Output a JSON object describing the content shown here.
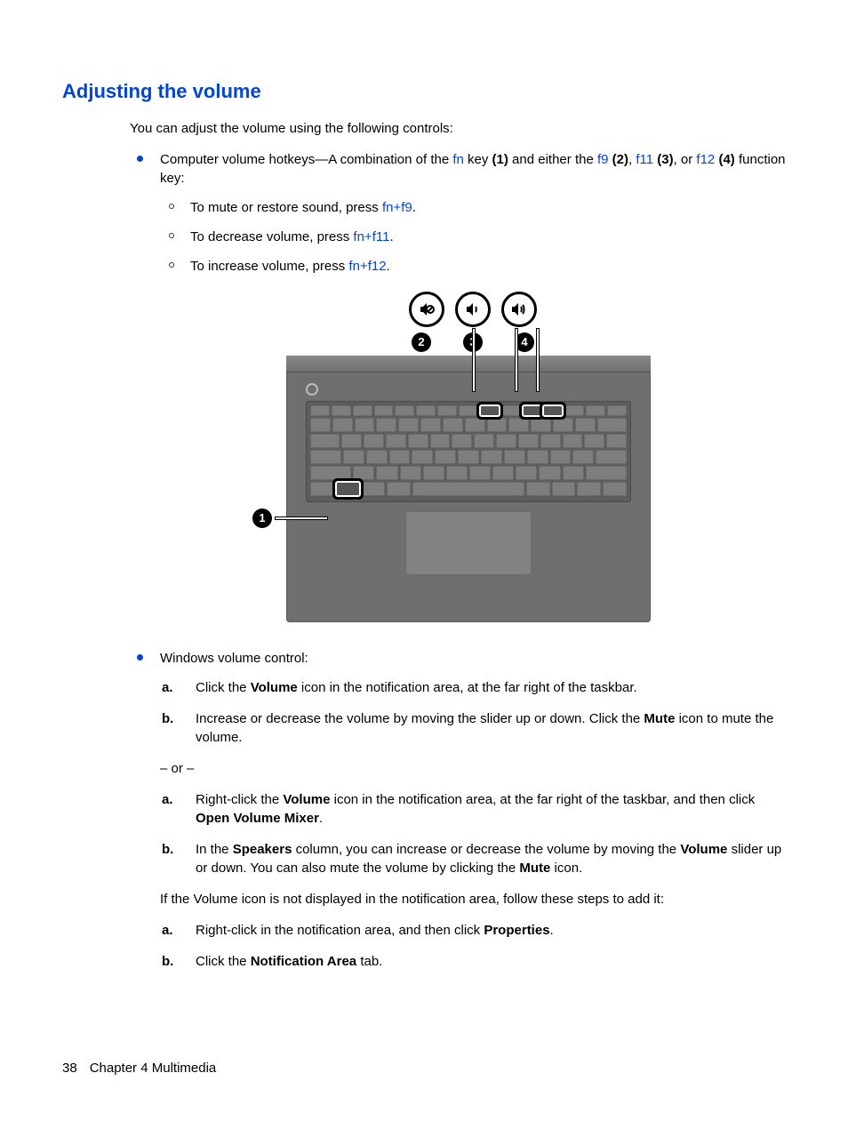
{
  "title": "Adjusting the volume",
  "intro": "You can adjust the volume using the following controls:",
  "bullet1_pre": "Computer volume hotkeys—A combination of the ",
  "fn": "fn",
  "bullet1_mid1": " key ",
  "b1_bold1": "(1)",
  "bullet1_mid2": " and either the ",
  "f9": "f9",
  "b1_bold2": " (2)",
  "comma1": ", ",
  "f11": "f11",
  "b1_bold3": " (3)",
  "comma2": ", or ",
  "f12": "f12",
  "b1_bold4": "(4)",
  "bullet1_end": " function key:",
  "sub1_pre": "To mute or restore sound, press ",
  "sub1_key": "fn+f9",
  "sub2_pre": "To decrease volume, press ",
  "sub2_key": "fn+f11",
  "sub3_pre": "To increase volume, press ",
  "sub3_key": "fn+f12",
  "period": ".",
  "bullet2": "Windows volume control:",
  "a1_pre": "Click the ",
  "a1_b": "Volume",
  "a1_post": " icon in the notification area, at the far right of the taskbar.",
  "b1_pre": "Increase or decrease the volume by moving the slider up or down. Click the ",
  "b1_b": "Mute",
  "b1_post": " icon to mute the volume.",
  "or": "– or –",
  "a2_pre": "Right-click the ",
  "a2_b1": "Volume",
  "a2_mid": " icon in the notification area, at the far right of the taskbar, and then click ",
  "a2_b2": "Open Volume Mixer",
  "b2_pre": "In the ",
  "b2_b1": "Speakers",
  "b2_mid1": " column, you can increase or decrease the volume by moving the ",
  "b2_b2": "Volume",
  "b2_mid2": " slider up or down. You can also mute the volume by clicking the ",
  "b2_b3": "Mute",
  "b2_post": " icon.",
  "if_not": "If the Volume icon is not displayed in the notification area, follow these steps to add it:",
  "a3_pre": "Right-click in the notification area, and then click ",
  "a3_b": "Properties",
  "b3_pre": "Click the ",
  "b3_b": "Notification Area",
  "b3_post": " tab.",
  "marker_a": "a.",
  "marker_b": "b.",
  "callout_2": "2",
  "callout_3": "3",
  "callout_4": "4",
  "callout_1": "1",
  "footer_page": "38",
  "footer_chap": "Chapter 4   Multimedia"
}
